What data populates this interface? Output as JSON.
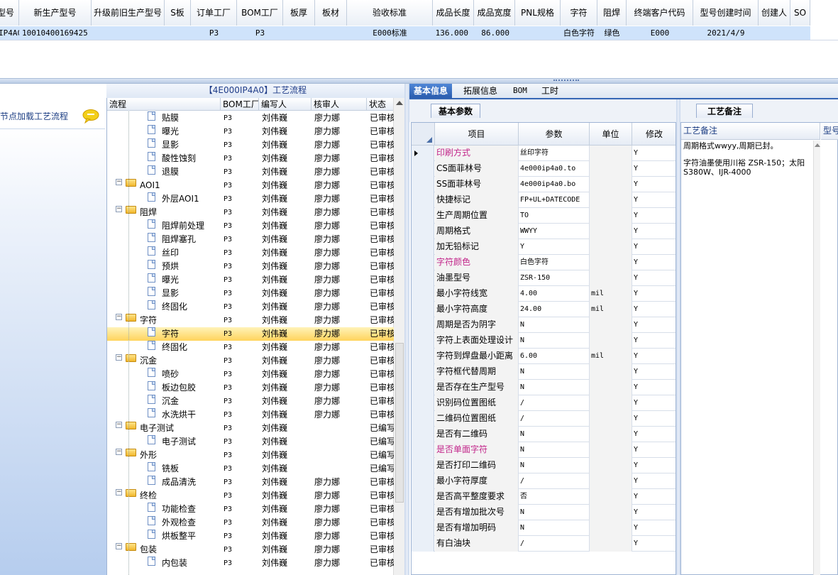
{
  "top_grid": {
    "headers": [
      "型号",
      "新生产型号",
      "升级前旧生产型号",
      "S板",
      "订单工厂",
      "BOM工厂",
      "板厚",
      "板材",
      "验收标准",
      "成品长度",
      "成品宽度",
      "PNL规格",
      "字符",
      "阻焊",
      "终端客户代码",
      "型号创建时间",
      "创建人",
      "SO"
    ],
    "row": [
      "IP4A0",
      "10010400169425",
      "",
      "",
      "P3",
      "P3",
      "",
      "",
      "E000标准",
      "136.000",
      "86.000",
      "",
      "白色字符",
      "绿色",
      "E000",
      "2021/4/9",
      "",
      ""
    ]
  },
  "left_panel": {
    "caption": "节点加载工艺流程",
    "bubble_icon": "speech-bubble-icon"
  },
  "process": {
    "title": "【4E000IP4A0】工艺流程",
    "headers": [
      "流程",
      "BOM工厂",
      "编写人",
      "核审人",
      "状态"
    ],
    "rows": [
      {
        "level": 2,
        "type": "doc",
        "name": "贴膜",
        "factory": "P3",
        "writer": "刘伟巍",
        "reviewer": "廖力娜",
        "status": "已审核"
      },
      {
        "level": 2,
        "type": "doc",
        "name": "曝光",
        "factory": "P3",
        "writer": "刘伟巍",
        "reviewer": "廖力娜",
        "status": "已审核"
      },
      {
        "level": 2,
        "type": "doc",
        "name": "显影",
        "factory": "P3",
        "writer": "刘伟巍",
        "reviewer": "廖力娜",
        "status": "已审核"
      },
      {
        "level": 2,
        "type": "doc",
        "name": "酸性蚀刻",
        "factory": "P3",
        "writer": "刘伟巍",
        "reviewer": "廖力娜",
        "status": "已审核"
      },
      {
        "level": 2,
        "type": "doc",
        "name": "退膜",
        "factory": "P3",
        "writer": "刘伟巍",
        "reviewer": "廖力娜",
        "status": "已审核"
      },
      {
        "level": 1,
        "type": "folder",
        "name": "AOI1",
        "factory": "P3",
        "writer": "刘伟巍",
        "reviewer": "廖力娜",
        "status": "已审核"
      },
      {
        "level": 2,
        "type": "doc",
        "name": "外层AOI1",
        "factory": "P3",
        "writer": "刘伟巍",
        "reviewer": "廖力娜",
        "status": "已审核"
      },
      {
        "level": 1,
        "type": "folder",
        "name": "阻焊",
        "factory": "P3",
        "writer": "刘伟巍",
        "reviewer": "廖力娜",
        "status": "已审核"
      },
      {
        "level": 2,
        "type": "doc",
        "name": "阻焊前处理",
        "factory": "P3",
        "writer": "刘伟巍",
        "reviewer": "廖力娜",
        "status": "已审核"
      },
      {
        "level": 2,
        "type": "doc",
        "name": "阻焊塞孔",
        "factory": "P3",
        "writer": "刘伟巍",
        "reviewer": "廖力娜",
        "status": "已审核"
      },
      {
        "level": 2,
        "type": "doc",
        "name": "丝印",
        "factory": "P3",
        "writer": "刘伟巍",
        "reviewer": "廖力娜",
        "status": "已审核"
      },
      {
        "level": 2,
        "type": "doc",
        "name": "预烘",
        "factory": "P3",
        "writer": "刘伟巍",
        "reviewer": "廖力娜",
        "status": "已审核"
      },
      {
        "level": 2,
        "type": "doc",
        "name": "曝光",
        "factory": "P3",
        "writer": "刘伟巍",
        "reviewer": "廖力娜",
        "status": "已审核"
      },
      {
        "level": 2,
        "type": "doc",
        "name": "显影",
        "factory": "P3",
        "writer": "刘伟巍",
        "reviewer": "廖力娜",
        "status": "已审核"
      },
      {
        "level": 2,
        "type": "doc",
        "name": "终固化",
        "factory": "P3",
        "writer": "刘伟巍",
        "reviewer": "廖力娜",
        "status": "已审核"
      },
      {
        "level": 1,
        "type": "folder",
        "name": "字符",
        "factory": "P3",
        "writer": "刘伟巍",
        "reviewer": "廖力娜",
        "status": "已审核"
      },
      {
        "level": 2,
        "type": "doc",
        "name": "字符",
        "factory": "P3",
        "writer": "刘伟巍",
        "reviewer": "廖力娜",
        "status": "已审核",
        "selected": true
      },
      {
        "level": 2,
        "type": "doc",
        "name": "终固化",
        "factory": "P3",
        "writer": "刘伟巍",
        "reviewer": "廖力娜",
        "status": "已审核"
      },
      {
        "level": 1,
        "type": "folder",
        "name": "沉金",
        "factory": "P3",
        "writer": "刘伟巍",
        "reviewer": "廖力娜",
        "status": "已审核"
      },
      {
        "level": 2,
        "type": "doc",
        "name": "喷砂",
        "factory": "P3",
        "writer": "刘伟巍",
        "reviewer": "廖力娜",
        "status": "已审核"
      },
      {
        "level": 2,
        "type": "doc",
        "name": "板边包胶",
        "factory": "P3",
        "writer": "刘伟巍",
        "reviewer": "廖力娜",
        "status": "已审核"
      },
      {
        "level": 2,
        "type": "doc",
        "name": "沉金",
        "factory": "P3",
        "writer": "刘伟巍",
        "reviewer": "廖力娜",
        "status": "已审核"
      },
      {
        "level": 2,
        "type": "doc",
        "name": "水洗烘干",
        "factory": "P3",
        "writer": "刘伟巍",
        "reviewer": "廖力娜",
        "status": "已审核"
      },
      {
        "level": 1,
        "type": "folder",
        "name": "电子测试",
        "factory": "P3",
        "writer": "刘伟巍",
        "reviewer": "",
        "status": "已编写"
      },
      {
        "level": 2,
        "type": "doc",
        "name": "电子测试",
        "factory": "P3",
        "writer": "刘伟巍",
        "reviewer": "",
        "status": "已编写"
      },
      {
        "level": 1,
        "type": "folder",
        "name": "外形",
        "factory": "P3",
        "writer": "刘伟巍",
        "reviewer": "",
        "status": "已编写"
      },
      {
        "level": 2,
        "type": "doc",
        "name": "铣板",
        "factory": "P3",
        "writer": "刘伟巍",
        "reviewer": "",
        "status": "已编写"
      },
      {
        "level": 2,
        "type": "doc",
        "name": "成品清洗",
        "factory": "P3",
        "writer": "刘伟巍",
        "reviewer": "廖力娜",
        "status": "已审核"
      },
      {
        "level": 1,
        "type": "folder",
        "name": "终检",
        "factory": "P3",
        "writer": "刘伟巍",
        "reviewer": "廖力娜",
        "status": "已审核"
      },
      {
        "level": 2,
        "type": "doc",
        "name": "功能检查",
        "factory": "P3",
        "writer": "刘伟巍",
        "reviewer": "廖力娜",
        "status": "已审核"
      },
      {
        "level": 2,
        "type": "doc",
        "name": "外观检查",
        "factory": "P3",
        "writer": "刘伟巍",
        "reviewer": "廖力娜",
        "status": "已审核"
      },
      {
        "level": 2,
        "type": "doc",
        "name": "烘板整平",
        "factory": "P3",
        "writer": "刘伟巍",
        "reviewer": "廖力娜",
        "status": "已审核"
      },
      {
        "level": 1,
        "type": "folder",
        "name": "包装",
        "factory": "P3",
        "writer": "刘伟巍",
        "reviewer": "廖力娜",
        "status": "已审核"
      },
      {
        "level": 2,
        "type": "doc",
        "name": "内包装",
        "factory": "P3",
        "writer": "刘伟巍",
        "reviewer": "廖力娜",
        "status": "已审核"
      }
    ]
  },
  "tabs": [
    "基本信息",
    "拓展信息",
    "BOM",
    "工时"
  ],
  "basic_params": {
    "tab": "基本参数",
    "headers": [
      "项目",
      "参数",
      "单位",
      "修改"
    ],
    "rows": [
      {
        "name": "印刷方式",
        "value": "丝印字符",
        "unit": "",
        "edit": "Y",
        "pink": true,
        "current": true
      },
      {
        "name": "CS面菲林号",
        "value": "4e000ip4a0.to",
        "unit": "",
        "edit": "Y"
      },
      {
        "name": "SS面菲林号",
        "value": "4e000ip4a0.bo",
        "unit": "",
        "edit": "Y"
      },
      {
        "name": "快捷标记",
        "value": "FP+UL+DATECODE",
        "unit": "",
        "edit": "Y"
      },
      {
        "name": "生产周期位置",
        "value": "TO",
        "unit": "",
        "edit": "Y"
      },
      {
        "name": "周期格式",
        "value": "WWYY",
        "unit": "",
        "edit": "Y"
      },
      {
        "name": "加无铅标记",
        "value": "Y",
        "unit": "",
        "edit": "Y"
      },
      {
        "name": "字符颜色",
        "value": "白色字符",
        "unit": "",
        "edit": "Y",
        "pink": true
      },
      {
        "name": "油墨型号",
        "value": "ZSR-150",
        "unit": "",
        "edit": "Y"
      },
      {
        "name": "最小字符线宽",
        "value": "4.00",
        "unit": "mil",
        "edit": "Y"
      },
      {
        "name": "最小字符高度",
        "value": "24.00",
        "unit": "mil",
        "edit": "Y"
      },
      {
        "name": "周期是否为阴字",
        "value": "N",
        "unit": "",
        "edit": "Y"
      },
      {
        "name": "字符上表面处理设计",
        "value": "N",
        "unit": "",
        "edit": "Y"
      },
      {
        "name": "字符到焊盘最小距离",
        "value": "6.00",
        "unit": "mil",
        "edit": "Y"
      },
      {
        "name": "字符框代替周期",
        "value": "N",
        "unit": "",
        "edit": "Y"
      },
      {
        "name": "是否存在生产型号",
        "value": "N",
        "unit": "",
        "edit": "Y"
      },
      {
        "name": "识别码位置图纸",
        "value": "/",
        "unit": "",
        "edit": "Y"
      },
      {
        "name": "二维码位置图纸",
        "value": "/",
        "unit": "",
        "edit": "Y"
      },
      {
        "name": "是否有二维码",
        "value": "N",
        "unit": "",
        "edit": "Y"
      },
      {
        "name": "是否单面字符",
        "value": "N",
        "unit": "",
        "edit": "Y",
        "pink": true
      },
      {
        "name": "是否打印二维码",
        "value": "N",
        "unit": "",
        "edit": "Y"
      },
      {
        "name": "最小字符厚度",
        "value": "/",
        "unit": "",
        "edit": "Y"
      },
      {
        "name": "是否高平整度要求",
        "value": "否",
        "unit": "",
        "edit": "Y"
      },
      {
        "name": "是否有增加批次号",
        "value": "N",
        "unit": "",
        "edit": "Y"
      },
      {
        "name": "是否有增加明码",
        "value": "N",
        "unit": "",
        "edit": "Y"
      },
      {
        "name": "有白油块",
        "value": "/",
        "unit": "",
        "edit": "Y"
      }
    ]
  },
  "remarks": {
    "tab": "工艺备注",
    "col1": "工艺备注",
    "col2": "型号",
    "line1": "周期格式wwyy,周期已封。",
    "line2": "字符油墨使用川裕 ZSR-150；太阳S380W、IJR-4000"
  }
}
